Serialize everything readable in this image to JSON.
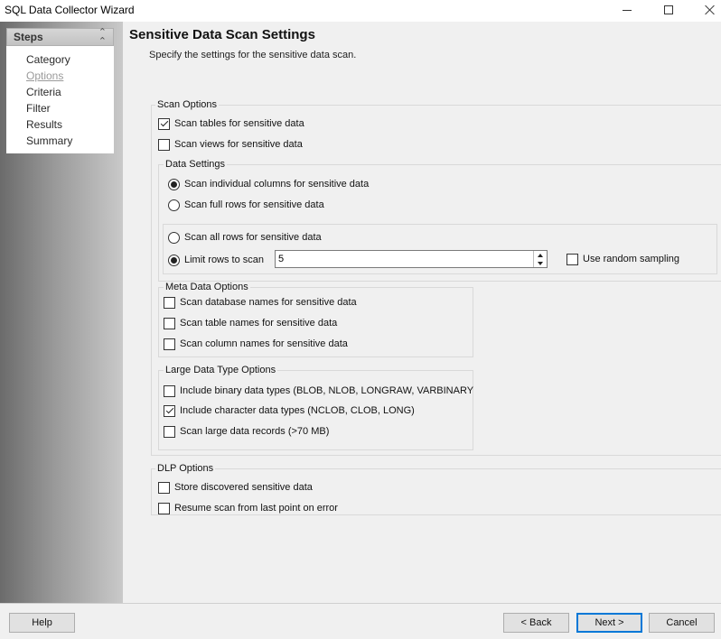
{
  "window": {
    "title": "SQL Data Collector Wizard"
  },
  "steps": {
    "header": "Steps",
    "items": [
      {
        "label": "Category",
        "current": false
      },
      {
        "label": "Options",
        "current": true
      },
      {
        "label": "Criteria",
        "current": false
      },
      {
        "label": "Filter",
        "current": false
      },
      {
        "label": "Results",
        "current": false
      },
      {
        "label": "Summary",
        "current": false
      }
    ]
  },
  "page": {
    "title": "Sensitive Data Scan Settings",
    "subtitle": "Specify the settings for the sensitive data scan."
  },
  "scan_options": {
    "label": "Scan Options",
    "scan_tables": {
      "label": "Scan tables for sensitive data",
      "checked": true
    },
    "scan_views": {
      "label": "Scan views for sensitive data",
      "checked": false
    }
  },
  "data_settings": {
    "label": "Data Settings",
    "individual_columns": {
      "label": "Scan individual columns for sensitive data",
      "selected": true
    },
    "full_rows": {
      "label": "Scan full rows for sensitive data",
      "selected": false
    },
    "all_rows": {
      "label": "Scan all rows for sensitive data",
      "selected": false
    },
    "limit_rows": {
      "label": "Limit rows to scan",
      "selected": true,
      "value": "5"
    },
    "random_sampling": {
      "label": "Use random sampling",
      "checked": false
    }
  },
  "meta_data_options": {
    "label": "Meta Data Options",
    "database_names": {
      "label": "Scan database names for sensitive data",
      "checked": false
    },
    "table_names": {
      "label": "Scan table names for sensitive data",
      "checked": false
    },
    "column_names": {
      "label": "Scan column names for sensitive data",
      "checked": false
    }
  },
  "large_data_type_options": {
    "label": "Large Data Type Options",
    "binary_types": {
      "label": "Include binary data types (BLOB, NLOB, LONGRAW, VARBINARY",
      "checked": false
    },
    "character_types": {
      "label": "Include character data types (NCLOB, CLOB, LONG)",
      "checked": true
    },
    "large_records": {
      "label": "Scan large data records (>70 MB)",
      "checked": false
    }
  },
  "dlp_options": {
    "label": "DLP Options",
    "store_discovered": {
      "label": "Store discovered sensitive data",
      "checked": false
    },
    "resume_scan": {
      "label": "Resume scan from last point on error",
      "checked": false
    }
  },
  "buttons": {
    "help": "Help",
    "back": "< Back",
    "next": "Next >",
    "cancel": "Cancel"
  },
  "colors": {
    "accent": "#0078d7"
  }
}
